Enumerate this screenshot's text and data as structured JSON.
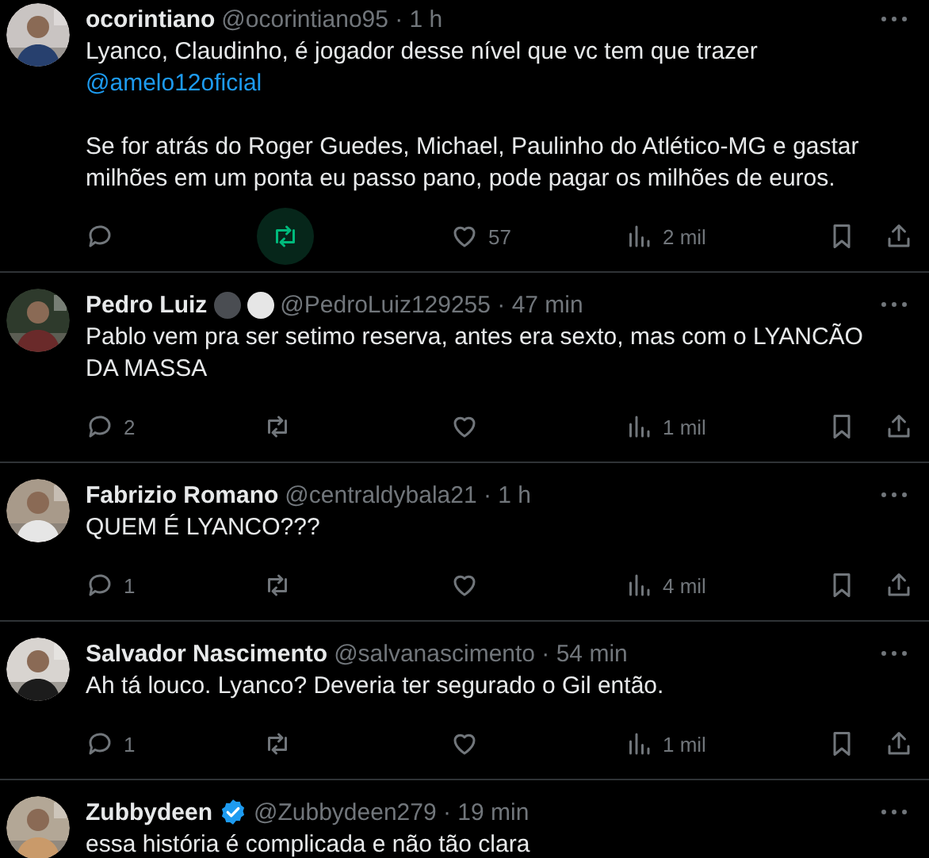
{
  "tweets": [
    {
      "avatar": {
        "kind": "picture"
      },
      "name": "ocorintiano",
      "byline": "@ocorintiano95 · 1 h",
      "body": [
        {
          "kind": "text",
          "text": "Lyanco, Claudinho, é jogador desse nível que vc tem que trazer"
        },
        {
          "kind": "mention",
          "text": "@amelo12oficial"
        },
        {
          "kind": "break"
        },
        {
          "kind": "text",
          "text": "Se for atrás do Roger Guedes, Michael, Paulinho do Atlético-MG e gastar milhões em um ponta eu passo pano, pode pagar os milhões de euros."
        }
      ],
      "actions": {
        "repost_highlighted": true,
        "likes": "57",
        "views": "2 mil"
      }
    },
    {
      "avatar": {
        "kind": "picture"
      },
      "name": "Pedro Luiz",
      "badges": [
        {
          "kind": "dot",
          "color": "#4a4d52"
        },
        {
          "kind": "dot",
          "color": "#e6e6e6"
        }
      ],
      "byline": "@PedroLuiz129255 · 47 min",
      "body": [
        {
          "kind": "text",
          "text": "Pablo vem pra ser setimo reserva, antes era sexto, mas com o LYANCÃO DA MASSA"
        }
      ],
      "actions": {
        "replies": "2",
        "repost_highlighted": false,
        "views": "1 mil"
      }
    },
    {
      "avatar": {
        "kind": "picture"
      },
      "name": "Fabrizio Romano",
      "byline": "@centraldybala21 · 1 h",
      "body": [
        {
          "kind": "text",
          "text": "QUEM É LYANCO???"
        }
      ],
      "actions": {
        "replies": "1",
        "repost_highlighted": false,
        "views": "4 mil"
      }
    },
    {
      "avatar": {
        "kind": "picture"
      },
      "name": "Salvador Nascimento",
      "byline": "@salvanascimento · 54 min",
      "body": [
        {
          "kind": "text",
          "text": "Ah tá louco. Lyanco? Deveria ter segurado o Gil então."
        }
      ],
      "actions": {
        "replies": "1",
        "repost_highlighted": false,
        "views": "1 mil"
      }
    },
    {
      "avatar": {
        "kind": "picture"
      },
      "name": "Zubbydeen",
      "badges": [
        {
          "kind": "verified"
        }
      ],
      "byline": "@Zubbydeen279 · 19 min",
      "body": [
        {
          "kind": "text",
          "text": "essa história é complicada e não tão clara"
        }
      ]
    }
  ]
}
